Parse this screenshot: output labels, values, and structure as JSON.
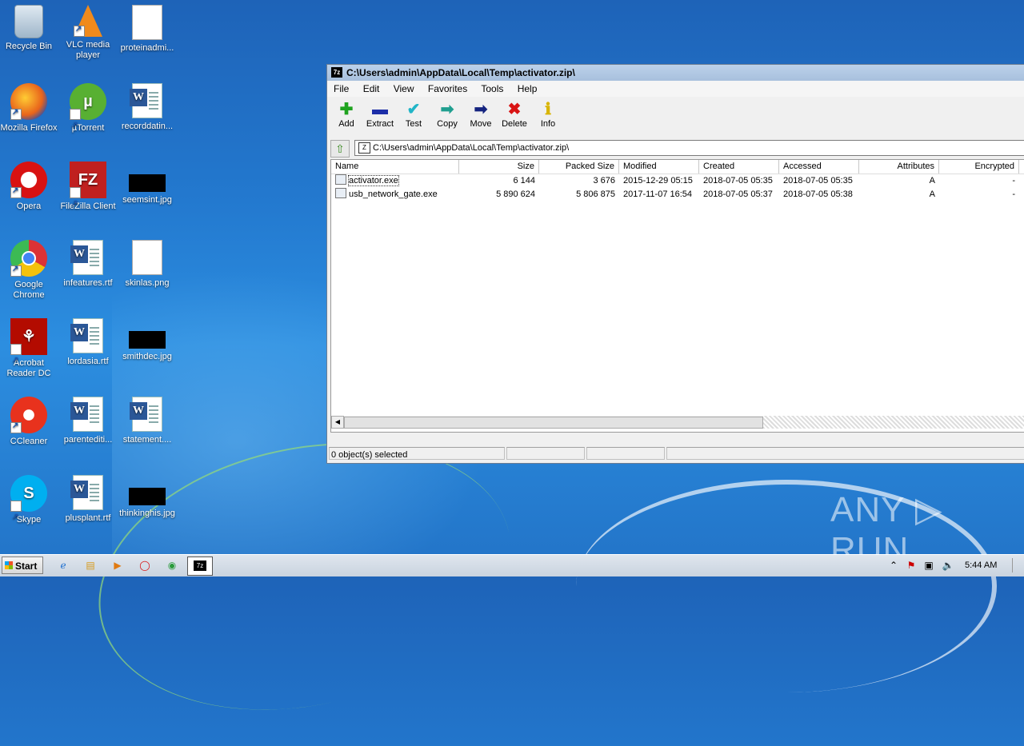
{
  "desktop": {
    "icons": [
      {
        "label": "Recycle Bin",
        "icon": "recycle-bin-icon"
      },
      {
        "label": "VLC media player",
        "icon": "vlc-icon"
      },
      {
        "label": "proteinadmi...",
        "icon": "blank-file-icon"
      },
      {
        "label": "Mozilla Firefox",
        "icon": "firefox-icon"
      },
      {
        "label": "µTorrent",
        "icon": "utorrent-icon"
      },
      {
        "label": "recorddatin...",
        "icon": "word-doc-icon"
      },
      {
        "label": "Opera",
        "icon": "opera-icon"
      },
      {
        "label": "FileZilla Client",
        "icon": "filezilla-icon"
      },
      {
        "label": "seemsint.jpg",
        "icon": "image-file-icon"
      },
      {
        "label": "Google Chrome",
        "icon": "chrome-icon"
      },
      {
        "label": "infeatures.rtf",
        "icon": "word-doc-icon"
      },
      {
        "label": "skinlas.png",
        "icon": "blank-file-icon"
      },
      {
        "label": "Acrobat Reader DC",
        "icon": "acrobat-icon"
      },
      {
        "label": "lordasia.rtf",
        "icon": "word-doc-icon"
      },
      {
        "label": "smithdec.jpg",
        "icon": "image-file-icon"
      },
      {
        "label": "CCleaner",
        "icon": "ccleaner-icon"
      },
      {
        "label": "parentediti...",
        "icon": "word-doc-icon"
      },
      {
        "label": "statement....",
        "icon": "word-doc-icon"
      },
      {
        "label": "Skype",
        "icon": "skype-icon"
      },
      {
        "label": "plusplant.rtf",
        "icon": "word-doc-icon"
      },
      {
        "label": "thinkinghis.jpg",
        "icon": "image-file-icon"
      }
    ]
  },
  "window": {
    "title": "C:\\Users\\admin\\AppData\\Local\\Temp\\activator.zip\\",
    "menu": [
      "File",
      "Edit",
      "View",
      "Favorites",
      "Tools",
      "Help"
    ],
    "toolbar": [
      {
        "label": "Add",
        "icon": "add-icon",
        "color": "#1fa31f"
      },
      {
        "label": "Extract",
        "icon": "extract-icon",
        "color": "#1c2ea8"
      },
      {
        "label": "Test",
        "icon": "test-icon",
        "color": "#21b5c7"
      },
      {
        "label": "Copy",
        "icon": "copy-icon",
        "color": "#1f9e8f"
      },
      {
        "label": "Move",
        "icon": "move-icon",
        "color": "#14237f"
      },
      {
        "label": "Delete",
        "icon": "delete-icon",
        "color": "#d91414"
      },
      {
        "label": "Info",
        "icon": "info-icon",
        "color": "#d8b400"
      }
    ],
    "address": "C:\\Users\\admin\\AppData\\Local\\Temp\\activator.zip\\",
    "columns": [
      "Name",
      "Size",
      "Packed Size",
      "Modified",
      "Created",
      "Accessed",
      "Attributes",
      "Encrypted"
    ],
    "rows": [
      {
        "name": "activator.exe",
        "size": "6 144",
        "packed": "3 676",
        "modified": "2015-12-29 05:15",
        "created": "2018-07-05 05:35",
        "accessed": "2018-07-05 05:35",
        "attributes": "A",
        "encrypted": "-"
      },
      {
        "name": "usb_network_gate.exe",
        "size": "5 890 624",
        "packed": "5 806 875",
        "modified": "2017-11-07 16:54",
        "created": "2018-07-05 05:37",
        "accessed": "2018-07-05 05:38",
        "attributes": "A",
        "encrypted": "-"
      }
    ],
    "status": "0 object(s) selected"
  },
  "watermark": "ANY ▷ RUN",
  "taskbar": {
    "start": "Start",
    "pinned": [
      "ie-icon",
      "explorer-icon",
      "media-player-icon",
      "opera-icon",
      "chrome-icon"
    ],
    "active_app": "7z",
    "clock": "5:44 AM"
  }
}
